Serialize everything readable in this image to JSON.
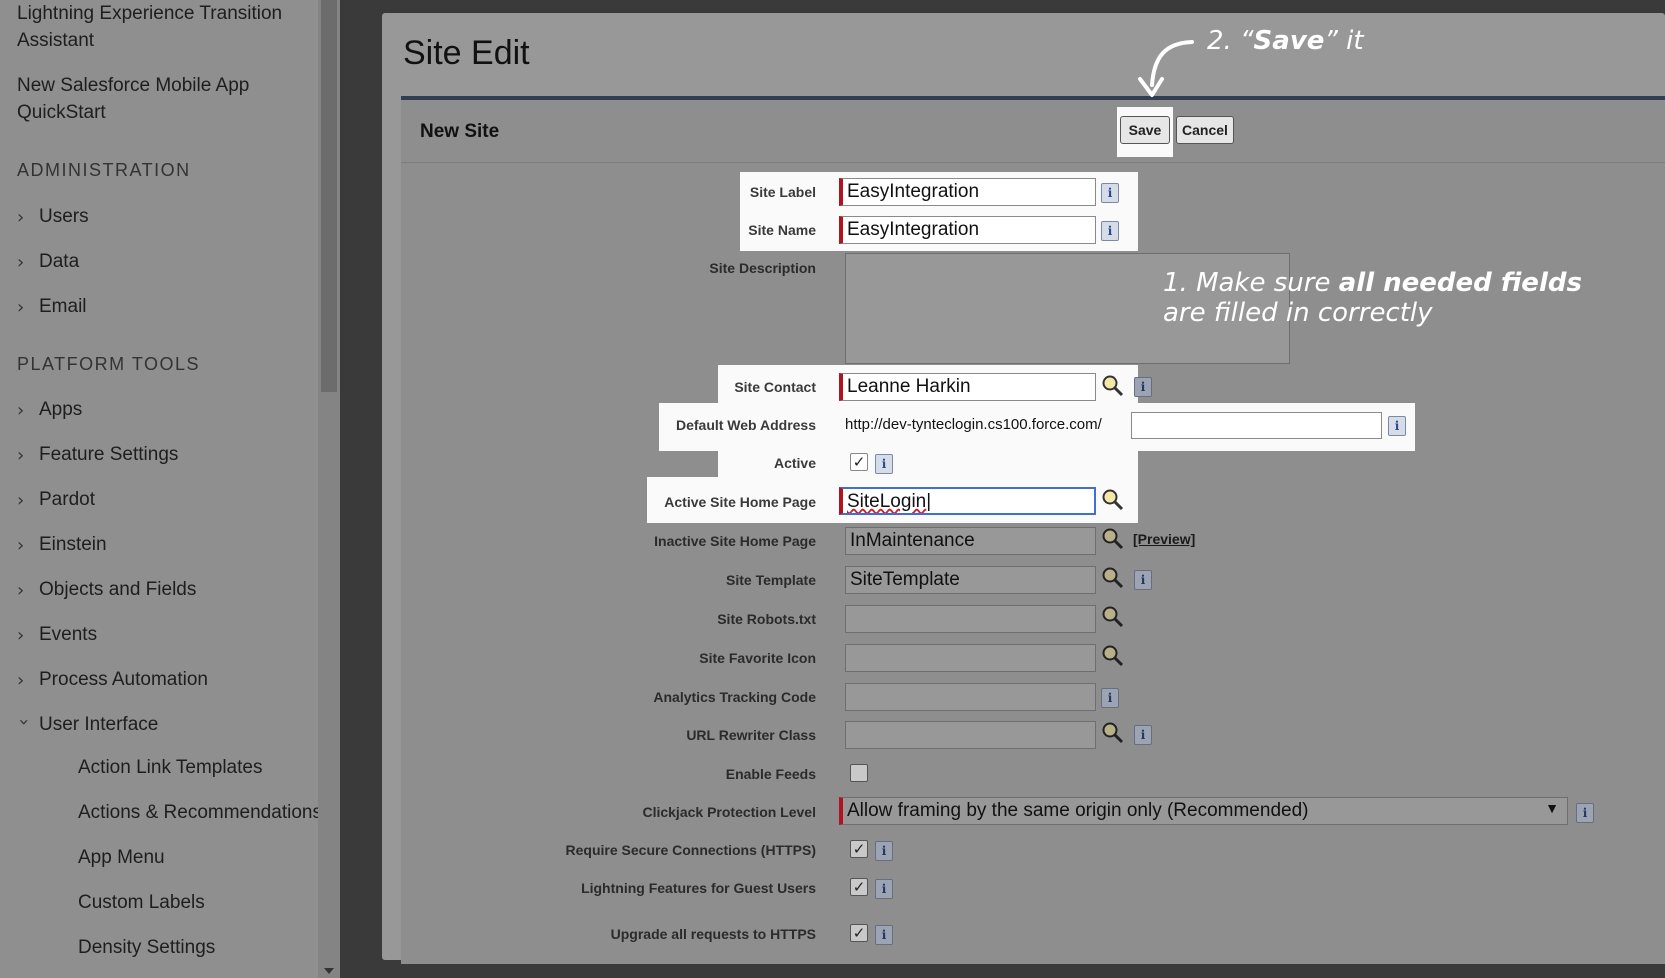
{
  "sidebar": {
    "top_links": [
      "Lightning Experience Transition Assistant",
      "New Salesforce Mobile App QuickStart"
    ],
    "sections": [
      {
        "title": "ADMINISTRATION",
        "items": [
          "Users",
          "Data",
          "Email"
        ]
      },
      {
        "title": "PLATFORM TOOLS",
        "items": [
          "Apps",
          "Feature Settings",
          "Pardot",
          "Einstein",
          "Objects and Fields",
          "Events",
          "Process Automation",
          "User Interface"
        ]
      }
    ],
    "ui_subitems": [
      "Action Link Templates",
      "Actions & Recommendations",
      "App Menu",
      "Custom Labels",
      "Density Settings"
    ]
  },
  "page": {
    "title": "Site Edit",
    "block_title": "New Site",
    "save_label": "Save",
    "cancel_label": "Cancel"
  },
  "form": {
    "site_label": {
      "label": "Site Label",
      "value": "EasyIntegration"
    },
    "site_name": {
      "label": "Site Name",
      "value": "EasyIntegration"
    },
    "site_description": {
      "label": "Site Description",
      "value": ""
    },
    "site_contact": {
      "label": "Site Contact",
      "value": "Leanne Harkin"
    },
    "default_web_address": {
      "label": "Default Web Address",
      "prefix": "http://dev-tynteclogin.cs100.force.com/",
      "value": ""
    },
    "active": {
      "label": "Active",
      "checked": true
    },
    "active_home": {
      "label": "Active Site Home Page",
      "value": "SiteLogin"
    },
    "inactive_home": {
      "label": "Inactive Site Home Page",
      "value": "InMaintenance",
      "preview": "[Preview]"
    },
    "site_template": {
      "label": "Site Template",
      "value": "SiteTemplate"
    },
    "robots": {
      "label": "Site Robots.txt",
      "value": ""
    },
    "favicon": {
      "label": "Site Favorite Icon",
      "value": ""
    },
    "analytics": {
      "label": "Analytics Tracking Code",
      "value": ""
    },
    "url_rewriter": {
      "label": "URL Rewriter Class",
      "value": ""
    },
    "enable_feeds": {
      "label": "Enable Feeds",
      "checked": false
    },
    "clickjack": {
      "label": "Clickjack Protection Level",
      "value": "Allow framing by the same origin only (Recommended)"
    },
    "https": {
      "label": "Require Secure Connections (HTTPS)",
      "checked": true
    },
    "lightning_guest": {
      "label": "Lightning Features for Guest Users",
      "checked": true
    },
    "upgrade_https": {
      "label": "Upgrade all requests to HTTPS",
      "checked": true
    }
  },
  "annotations": {
    "step2_prefix": "2. “",
    "step2_bold": "Save",
    "step2_suffix": "” it",
    "step1_prefix": "1. Make sure ",
    "step1_bold": "all needed fields",
    "step1_line2": "are filled in correctly"
  },
  "colors": {
    "required_bar": "#b0141e",
    "header_bar": "#2f3f52",
    "focus": "#3d6fd6"
  }
}
